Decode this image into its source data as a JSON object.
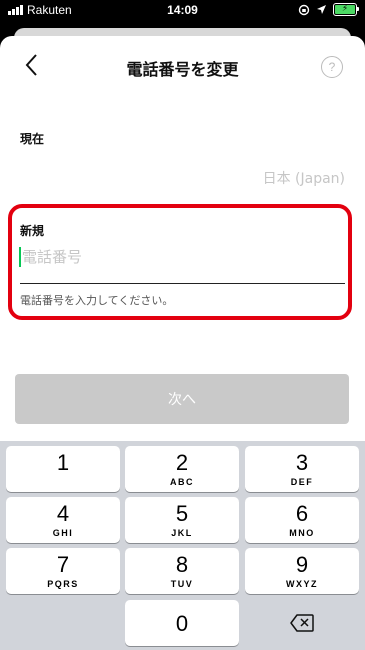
{
  "status_bar": {
    "carrier": "Rakuten",
    "time": "14:09"
  },
  "nav": {
    "title": "電話番号を変更",
    "back_icon": "chevron-left-icon",
    "help_label": "?"
  },
  "current": {
    "label": "現在",
    "country": "日本 (Japan)"
  },
  "new": {
    "label": "新規",
    "placeholder": "電話番号",
    "hint": "電話番号を入力してください。"
  },
  "next_button": {
    "label": "次へ"
  },
  "keypad": {
    "keys": [
      {
        "num": "1",
        "letters": ""
      },
      {
        "num": "2",
        "letters": "ABC"
      },
      {
        "num": "3",
        "letters": "DEF"
      },
      {
        "num": "4",
        "letters": "GHI"
      },
      {
        "num": "5",
        "letters": "JKL"
      },
      {
        "num": "6",
        "letters": "MNO"
      },
      {
        "num": "7",
        "letters": "PQRS"
      },
      {
        "num": "8",
        "letters": "TUV"
      },
      {
        "num": "9",
        "letters": "WXYZ"
      },
      {
        "num": "0",
        "letters": ""
      }
    ],
    "delete_icon": "backspace-icon"
  },
  "colors": {
    "accent_green": "#06c755",
    "highlight_red": "#e3000f",
    "disabled_button": "#c9c9c9"
  }
}
